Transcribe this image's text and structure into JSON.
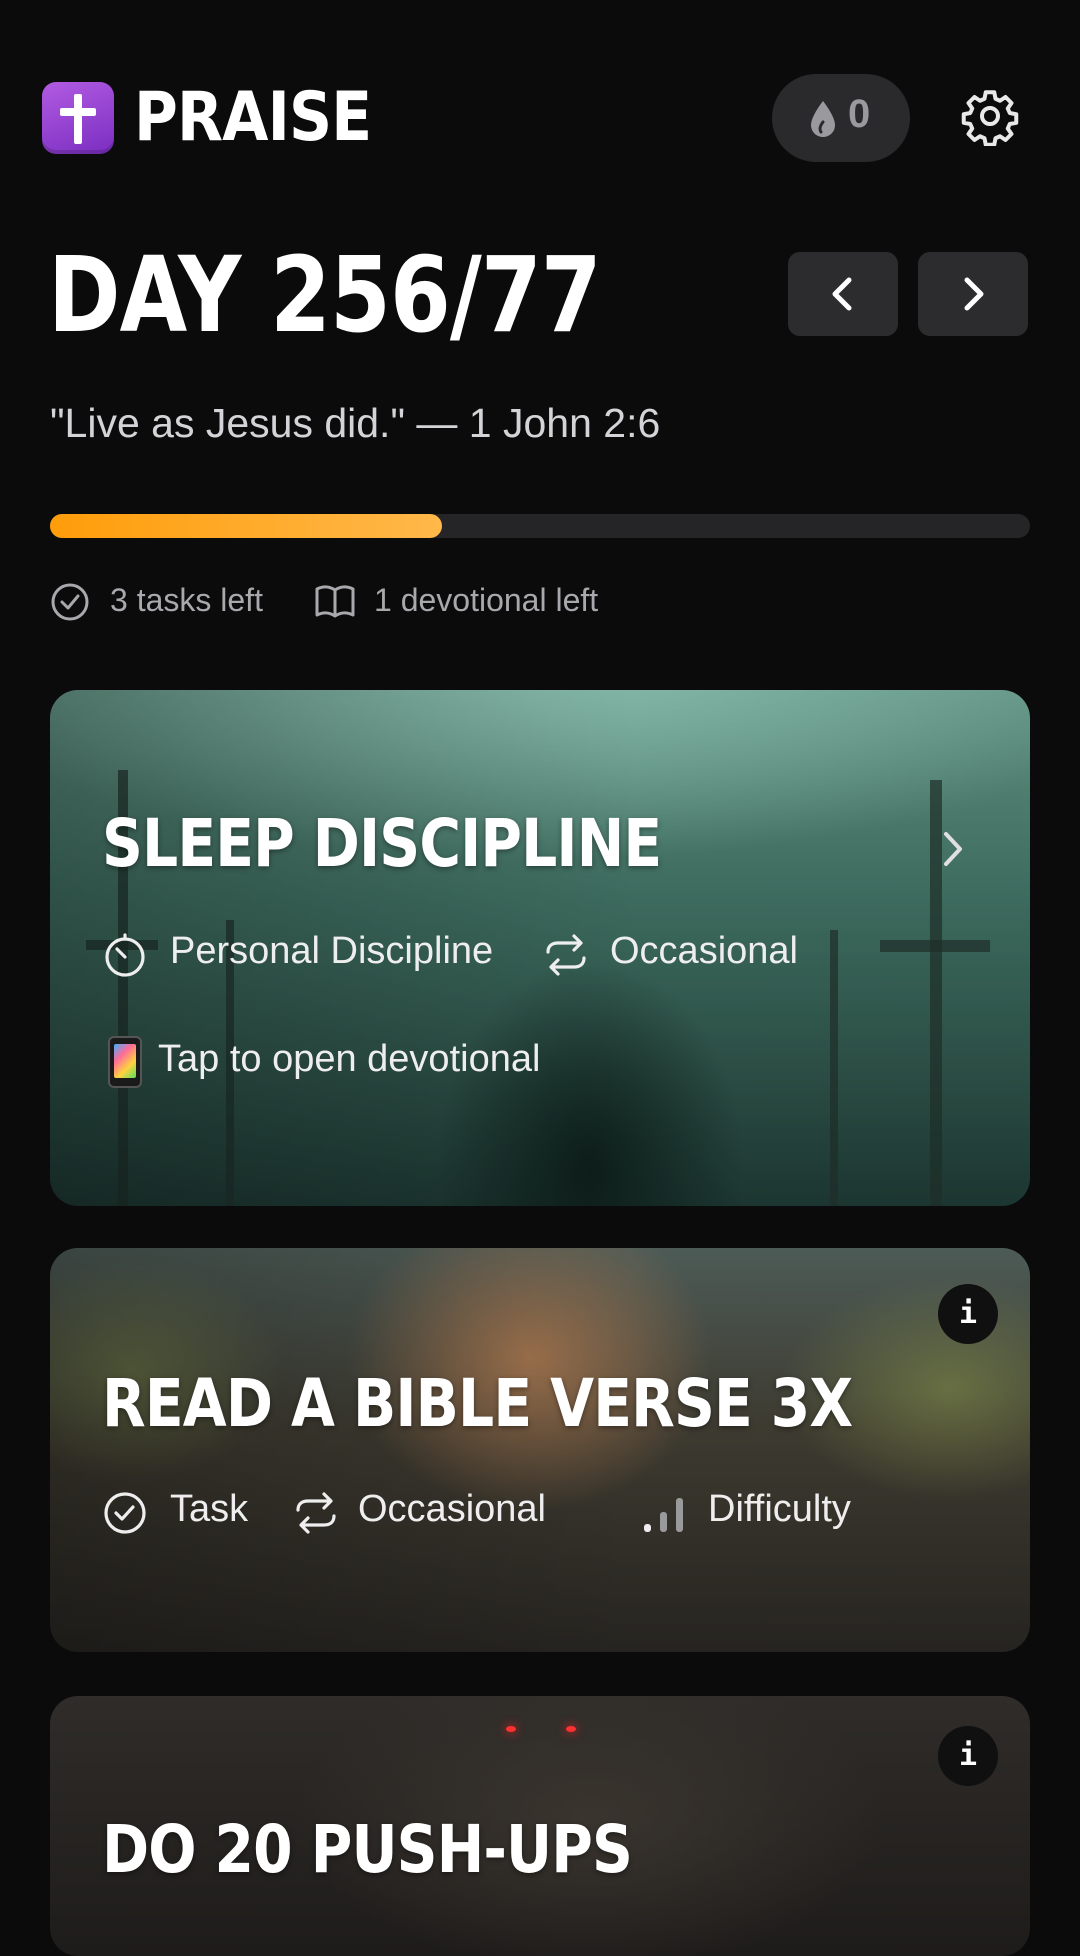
{
  "app": {
    "title": "PRAISE"
  },
  "header": {
    "streak_count": "0"
  },
  "day": {
    "title": "DAY 256/77",
    "quote": "\"Live as Jesus did.\" — 1 John 2:6",
    "progress": 0.4,
    "tasks_left": "3 tasks left",
    "devotionals_left": "1 devotional left"
  },
  "cards": [
    {
      "title": "SLEEP DISCIPLINE",
      "category": "Personal Discipline",
      "frequency": "Occasional",
      "action": "Tap to open devotional"
    },
    {
      "title": "READ A BIBLE VERSE 3X",
      "category": "Task",
      "frequency": "Occasional",
      "difficulty": "Difficulty",
      "info": "i"
    },
    {
      "title": "DO 20 PUSH-UPS",
      "info": "i"
    }
  ],
  "colors": {
    "accent": "#ff9d0a",
    "background": "#0b0b0c",
    "logo": "#9a44d6"
  }
}
